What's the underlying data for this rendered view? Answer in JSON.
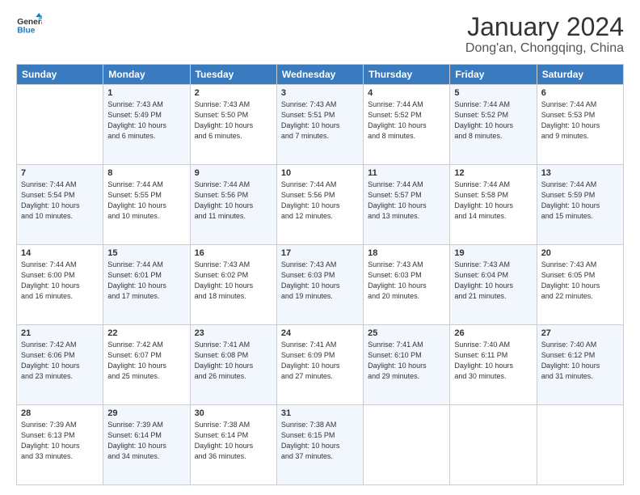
{
  "logo": {
    "text_general": "General",
    "text_blue": "Blue"
  },
  "header": {
    "title": "January 2024",
    "subtitle": "Dong'an, Chongqing, China"
  },
  "weekdays": [
    "Sunday",
    "Monday",
    "Tuesday",
    "Wednesday",
    "Thursday",
    "Friday",
    "Saturday"
  ],
  "weeks": [
    [
      {
        "day": "",
        "info": ""
      },
      {
        "day": "1",
        "info": "Sunrise: 7:43 AM\nSunset: 5:49 PM\nDaylight: 10 hours\nand 6 minutes."
      },
      {
        "day": "2",
        "info": "Sunrise: 7:43 AM\nSunset: 5:50 PM\nDaylight: 10 hours\nand 6 minutes."
      },
      {
        "day": "3",
        "info": "Sunrise: 7:43 AM\nSunset: 5:51 PM\nDaylight: 10 hours\nand 7 minutes."
      },
      {
        "day": "4",
        "info": "Sunrise: 7:44 AM\nSunset: 5:52 PM\nDaylight: 10 hours\nand 8 minutes."
      },
      {
        "day": "5",
        "info": "Sunrise: 7:44 AM\nSunset: 5:52 PM\nDaylight: 10 hours\nand 8 minutes."
      },
      {
        "day": "6",
        "info": "Sunrise: 7:44 AM\nSunset: 5:53 PM\nDaylight: 10 hours\nand 9 minutes."
      }
    ],
    [
      {
        "day": "7",
        "info": "Sunrise: 7:44 AM\nSunset: 5:54 PM\nDaylight: 10 hours\nand 10 minutes."
      },
      {
        "day": "8",
        "info": "Sunrise: 7:44 AM\nSunset: 5:55 PM\nDaylight: 10 hours\nand 10 minutes."
      },
      {
        "day": "9",
        "info": "Sunrise: 7:44 AM\nSunset: 5:56 PM\nDaylight: 10 hours\nand 11 minutes."
      },
      {
        "day": "10",
        "info": "Sunrise: 7:44 AM\nSunset: 5:56 PM\nDaylight: 10 hours\nand 12 minutes."
      },
      {
        "day": "11",
        "info": "Sunrise: 7:44 AM\nSunset: 5:57 PM\nDaylight: 10 hours\nand 13 minutes."
      },
      {
        "day": "12",
        "info": "Sunrise: 7:44 AM\nSunset: 5:58 PM\nDaylight: 10 hours\nand 14 minutes."
      },
      {
        "day": "13",
        "info": "Sunrise: 7:44 AM\nSunset: 5:59 PM\nDaylight: 10 hours\nand 15 minutes."
      }
    ],
    [
      {
        "day": "14",
        "info": "Sunrise: 7:44 AM\nSunset: 6:00 PM\nDaylight: 10 hours\nand 16 minutes."
      },
      {
        "day": "15",
        "info": "Sunrise: 7:44 AM\nSunset: 6:01 PM\nDaylight: 10 hours\nand 17 minutes."
      },
      {
        "day": "16",
        "info": "Sunrise: 7:43 AM\nSunset: 6:02 PM\nDaylight: 10 hours\nand 18 minutes."
      },
      {
        "day": "17",
        "info": "Sunrise: 7:43 AM\nSunset: 6:03 PM\nDaylight: 10 hours\nand 19 minutes."
      },
      {
        "day": "18",
        "info": "Sunrise: 7:43 AM\nSunset: 6:03 PM\nDaylight: 10 hours\nand 20 minutes."
      },
      {
        "day": "19",
        "info": "Sunrise: 7:43 AM\nSunset: 6:04 PM\nDaylight: 10 hours\nand 21 minutes."
      },
      {
        "day": "20",
        "info": "Sunrise: 7:43 AM\nSunset: 6:05 PM\nDaylight: 10 hours\nand 22 minutes."
      }
    ],
    [
      {
        "day": "21",
        "info": "Sunrise: 7:42 AM\nSunset: 6:06 PM\nDaylight: 10 hours\nand 23 minutes."
      },
      {
        "day": "22",
        "info": "Sunrise: 7:42 AM\nSunset: 6:07 PM\nDaylight: 10 hours\nand 25 minutes."
      },
      {
        "day": "23",
        "info": "Sunrise: 7:41 AM\nSunset: 6:08 PM\nDaylight: 10 hours\nand 26 minutes."
      },
      {
        "day": "24",
        "info": "Sunrise: 7:41 AM\nSunset: 6:09 PM\nDaylight: 10 hours\nand 27 minutes."
      },
      {
        "day": "25",
        "info": "Sunrise: 7:41 AM\nSunset: 6:10 PM\nDaylight: 10 hours\nand 29 minutes."
      },
      {
        "day": "26",
        "info": "Sunrise: 7:40 AM\nSunset: 6:11 PM\nDaylight: 10 hours\nand 30 minutes."
      },
      {
        "day": "27",
        "info": "Sunrise: 7:40 AM\nSunset: 6:12 PM\nDaylight: 10 hours\nand 31 minutes."
      }
    ],
    [
      {
        "day": "28",
        "info": "Sunrise: 7:39 AM\nSunset: 6:13 PM\nDaylight: 10 hours\nand 33 minutes."
      },
      {
        "day": "29",
        "info": "Sunrise: 7:39 AM\nSunset: 6:14 PM\nDaylight: 10 hours\nand 34 minutes."
      },
      {
        "day": "30",
        "info": "Sunrise: 7:38 AM\nSunset: 6:14 PM\nDaylight: 10 hours\nand 36 minutes."
      },
      {
        "day": "31",
        "info": "Sunrise: 7:38 AM\nSunset: 6:15 PM\nDaylight: 10 hours\nand 37 minutes."
      },
      {
        "day": "",
        "info": ""
      },
      {
        "day": "",
        "info": ""
      },
      {
        "day": "",
        "info": ""
      }
    ]
  ]
}
